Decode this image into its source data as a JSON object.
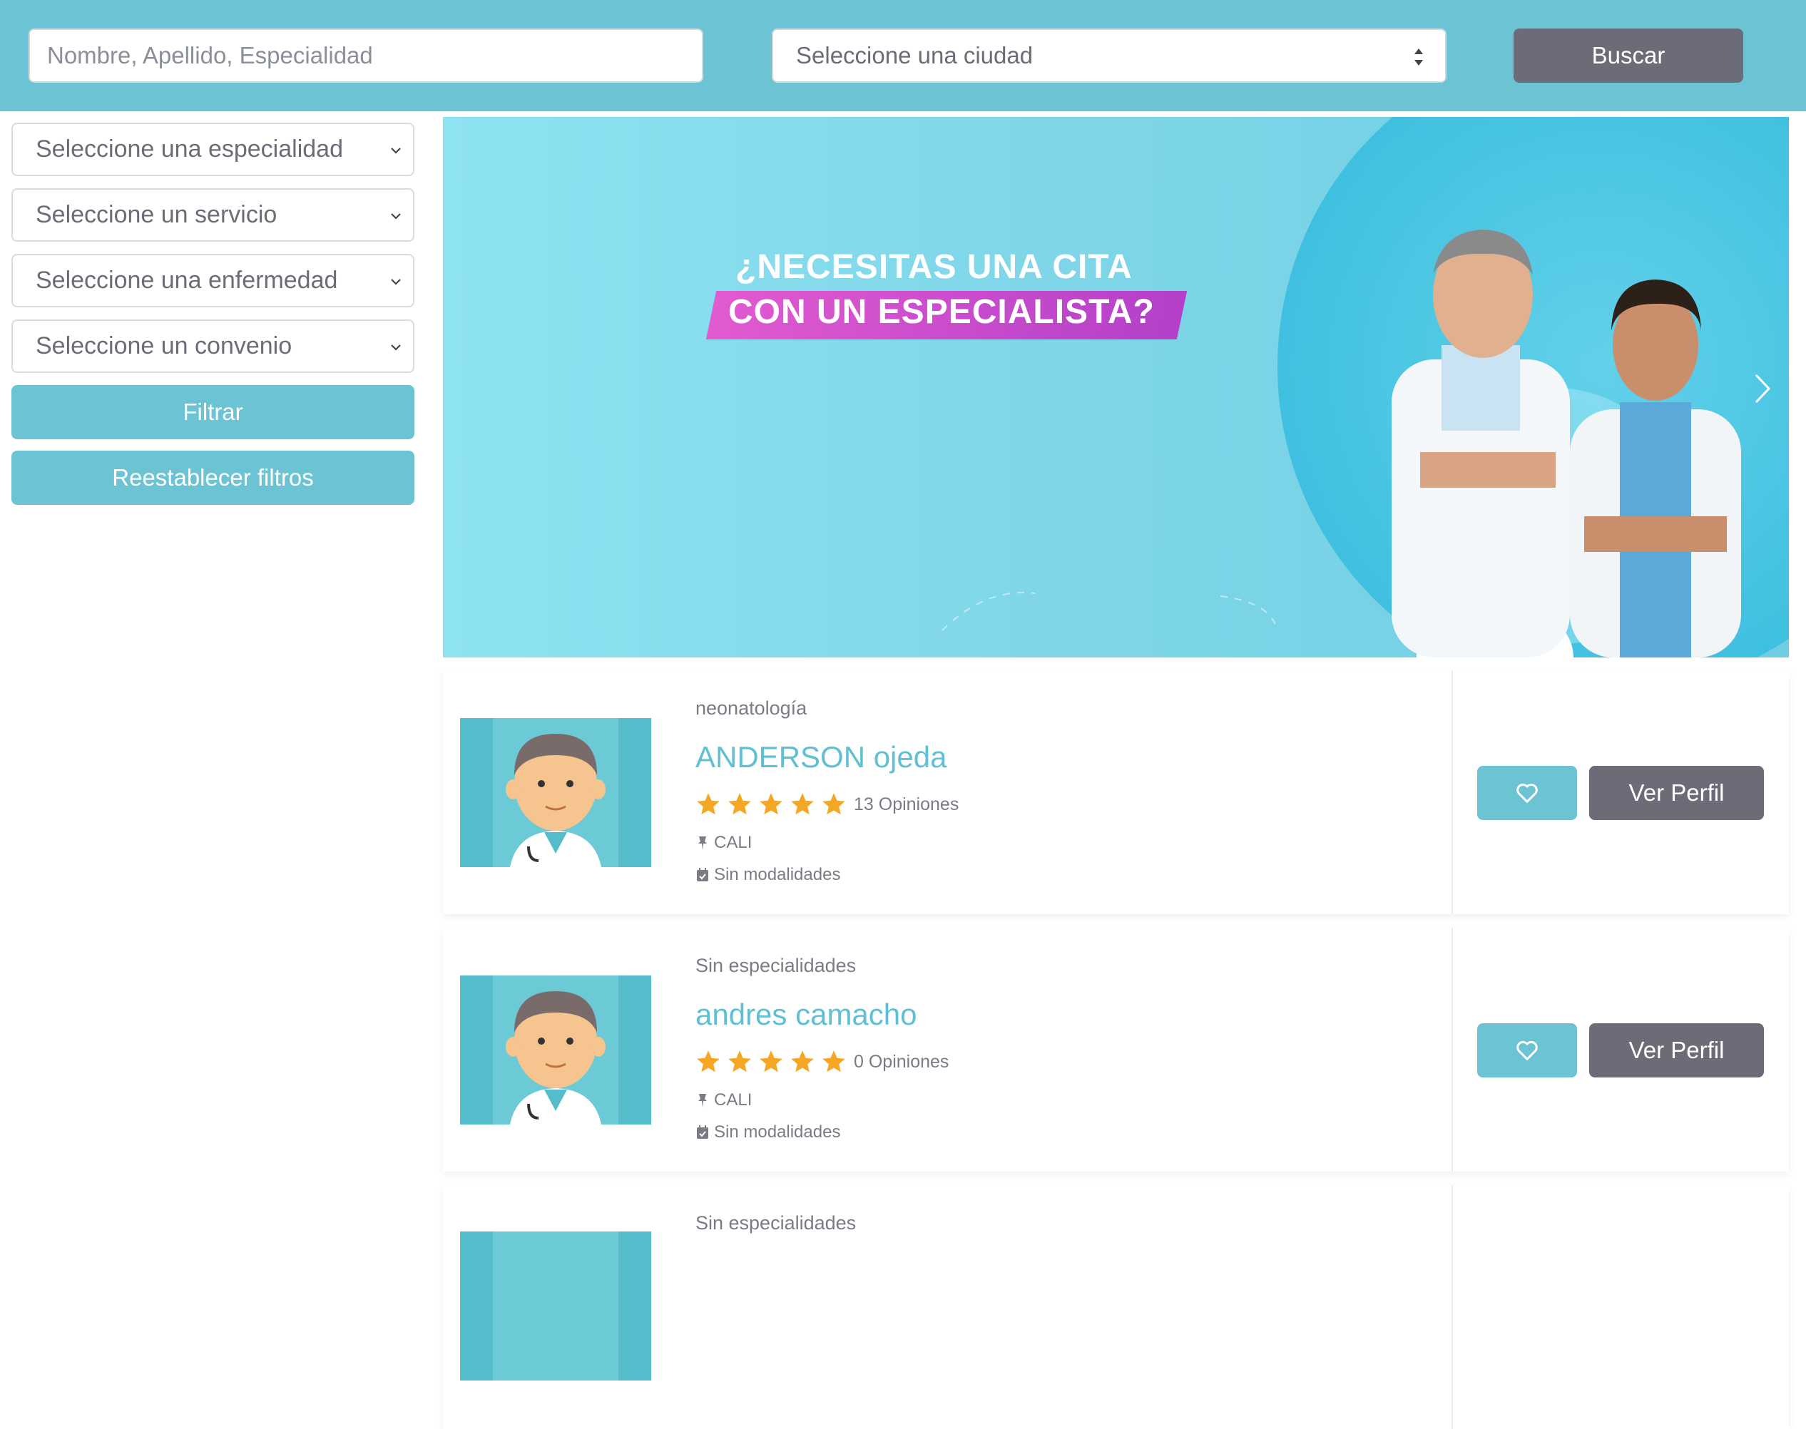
{
  "search": {
    "placeholder": "Nombre, Apellido, Especialidad",
    "city_label": "Seleccione una ciudad",
    "button": "Buscar"
  },
  "filters": {
    "especialidad": "Seleccione una especialidad",
    "servicio": "Seleccione un servicio",
    "enfermedad": "Seleccione una enfermedad",
    "convenio": "Seleccione un convenio",
    "filtrar": "Filtrar",
    "reset": "Reestablecer filtros"
  },
  "banner": {
    "line1": "¿NECESITAS UNA CITA",
    "line2": "CON UN ESPECIALISTA?"
  },
  "doctors": [
    {
      "specialty": "neonatología",
      "name": "ANDERSON ojeda",
      "rating": 5,
      "opinions": "13 Opiniones",
      "city": "CALI",
      "modalities": "Sin modalidades",
      "profile_button": "Ver Perfil"
    },
    {
      "specialty": "Sin especialidades",
      "name": "andres camacho",
      "rating": 5,
      "opinions": "0 Opiniones",
      "city": "CALI",
      "modalities": "Sin modalidades",
      "profile_button": "Ver Perfil"
    },
    {
      "specialty": "Sin especialidades"
    }
  ],
  "colors": {
    "primary": "#6cc3d4",
    "secondary": "#6b6c77",
    "star": "#f5a623",
    "name": "#5fc0d3"
  }
}
